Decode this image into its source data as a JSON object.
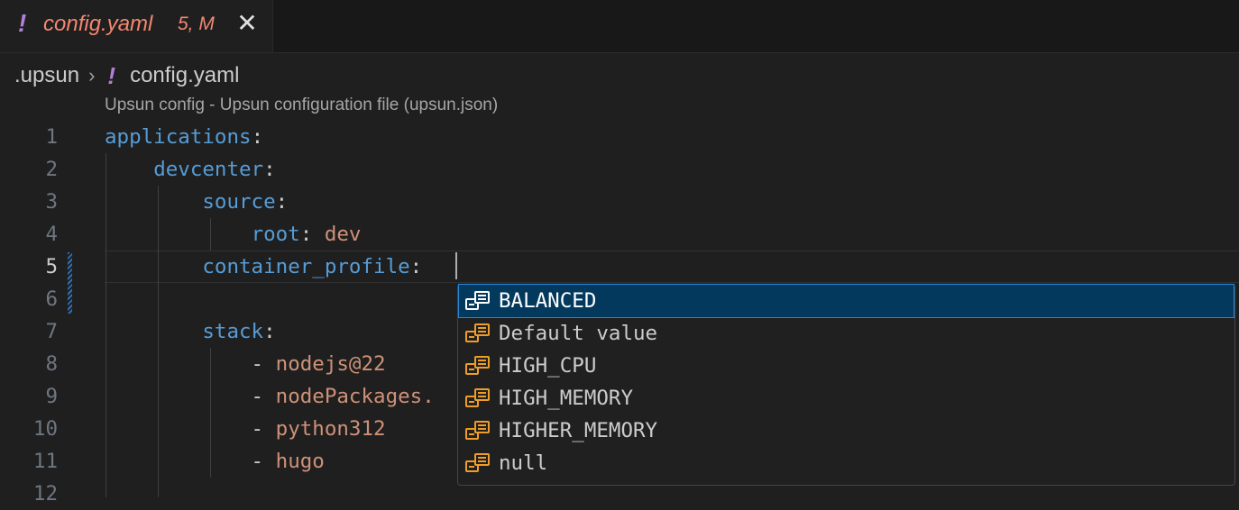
{
  "tab": {
    "modified_symbol": "!",
    "filename": "config.yaml",
    "status": "5, M",
    "close_icon": "close-icon"
  },
  "breadcrumb": {
    "folder": ".upsun",
    "chevron": "›",
    "file_symbol": "!",
    "file": "config.yaml"
  },
  "codelens": "Upsun config - Upsun configuration file (upsun.json)",
  "editor": {
    "lines": [
      {
        "num": "1",
        "key": "applications",
        "indent": "",
        "value": ""
      },
      {
        "num": "2",
        "key": "devcenter",
        "indent": "    ",
        "value": ""
      },
      {
        "num": "3",
        "key": "source",
        "indent": "        ",
        "value": ""
      },
      {
        "num": "4",
        "key": "root",
        "indent": "            ",
        "value": "dev"
      },
      {
        "num": "5",
        "key": "container_profile",
        "indent": "        ",
        "value": ""
      },
      {
        "num": "6",
        "key": "",
        "indent": "",
        "value": ""
      },
      {
        "num": "7",
        "key": "stack",
        "indent": "        ",
        "value": ""
      },
      {
        "num": "8",
        "list_item": "nodejs@22"
      },
      {
        "num": "9",
        "list_item": "nodePackages."
      },
      {
        "num": "10",
        "list_item": "python312"
      },
      {
        "num": "11",
        "list_item": "hugo"
      },
      {
        "num": "12"
      }
    ]
  },
  "suggestions": [
    {
      "label": "BALANCED",
      "selected": true
    },
    {
      "label": "Default value",
      "selected": false
    },
    {
      "label": "HIGH_CPU",
      "selected": false
    },
    {
      "label": "HIGH_MEMORY",
      "selected": false
    },
    {
      "label": "HIGHER_MEMORY",
      "selected": false
    },
    {
      "label": "null",
      "selected": false
    }
  ],
  "colors": {
    "keyword": "#569cd6",
    "string": "#ce9178",
    "modified": "#f48771",
    "suggest_selected": "#04395e",
    "enum_icon": "#ee9d28"
  }
}
